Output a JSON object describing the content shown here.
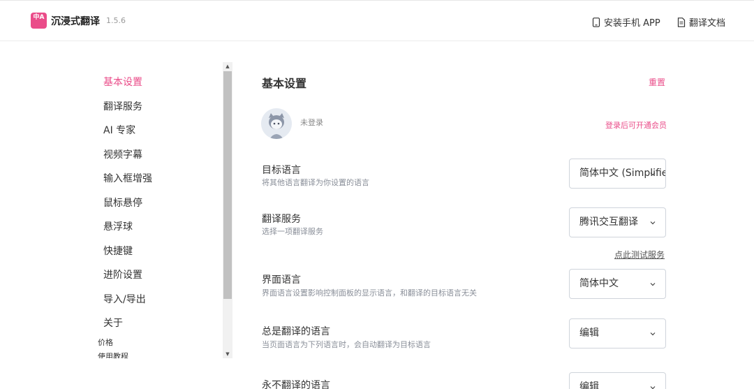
{
  "header": {
    "logo_glyph": "中A",
    "app_name": "沉浸式翻译",
    "version": "1.5.6",
    "install_app_label": "安装手机 APP",
    "docs_label": "翻译文档"
  },
  "sidebar": {
    "items": [
      {
        "label": "基本设置",
        "active": true
      },
      {
        "label": "翻译服务",
        "active": false
      },
      {
        "label": "AI 专家",
        "active": false
      },
      {
        "label": "视频字幕",
        "active": false
      },
      {
        "label": "输入框增强",
        "active": false
      },
      {
        "label": "鼠标悬停",
        "active": false
      },
      {
        "label": "悬浮球",
        "active": false
      },
      {
        "label": "快捷键",
        "active": false
      },
      {
        "label": "进阶设置",
        "active": false
      },
      {
        "label": "导入/导出",
        "active": false
      },
      {
        "label": "关于",
        "active": false
      }
    ],
    "small_items": [
      "价格",
      "使用教程"
    ]
  },
  "main": {
    "title": "基本设置",
    "reset_label": "重置",
    "account": {
      "status": "未登录",
      "member_link": "登录后可开通会员"
    },
    "rows": [
      {
        "label": "目标语言",
        "desc": "将其他语言翻译为你设置的语言",
        "value": "简体中文 (Simplified Chinese)"
      },
      {
        "label": "翻译服务",
        "desc": "选择一项翻译服务",
        "value": "腾讯交互翻译"
      },
      {
        "label": "界面语言",
        "desc": "界面语言设置影响控制面板的显示语言，和翻译的目标语言无关",
        "value": "简体中文"
      },
      {
        "label": "总是翻译的语言",
        "desc": "当页面语言为下列语言时，会自动翻译为目标语言",
        "value": "编辑"
      },
      {
        "label": "永不翻译的语言",
        "desc": "",
        "value": "编辑"
      }
    ],
    "test_service_link": "点此测试服务"
  },
  "colors": {
    "accent": "#ea4c89",
    "border": "#cfd4db",
    "muted_text": "#8a8f99"
  }
}
